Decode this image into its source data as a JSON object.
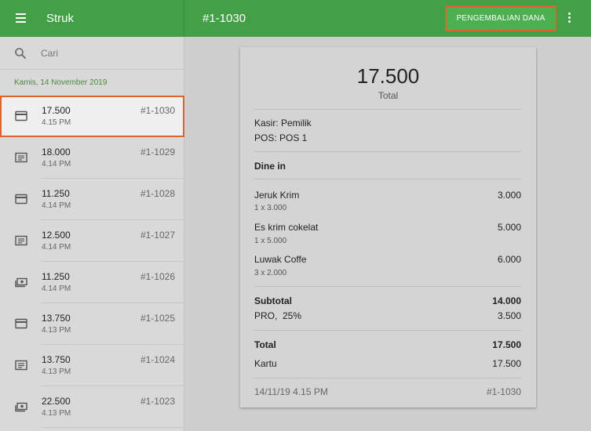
{
  "header": {
    "app_title": "Struk",
    "receipt_id": "#1-1030",
    "refund_label": "PENGEMBALIAN DANA",
    "menu_icon": "hamburger-menu-icon",
    "more_icon": "more-vert-icon"
  },
  "search": {
    "placeholder": "Cari"
  },
  "date_header": "Kamis, 14 November 2019",
  "receipts": [
    {
      "amount": "17.500",
      "time": "4.15 PM",
      "number": "#1-1030",
      "icon": "card-icon"
    },
    {
      "amount": "18.000",
      "time": "4.14 PM",
      "number": "#1-1029",
      "icon": "receipt-icon"
    },
    {
      "amount": "11.250",
      "time": "4.14 PM",
      "number": "#1-1028",
      "icon": "card-icon"
    },
    {
      "amount": "12.500",
      "time": "4.14 PM",
      "number": "#1-1027",
      "icon": "receipt-icon"
    },
    {
      "amount": "11.250",
      "time": "4.14 PM",
      "number": "#1-1026",
      "icon": "cash-icon"
    },
    {
      "amount": "13.750",
      "time": "4.13 PM",
      "number": "#1-1025",
      "icon": "card-icon"
    },
    {
      "amount": "13.750",
      "time": "4.13 PM",
      "number": "#1-1024",
      "icon": "receipt-icon"
    },
    {
      "amount": "22.500",
      "time": "4.13 PM",
      "number": "#1-1023",
      "icon": "cash-icon"
    }
  ],
  "receipt": {
    "total": "17.500",
    "total_label": "Total",
    "cashier": "Kasir: Pemilik",
    "pos": "POS: POS 1",
    "dining_option": "Dine in",
    "items": [
      {
        "name": "Jeruk Krim",
        "qty": "1 x 3.000",
        "price": "3.000"
      },
      {
        "name": "Es krim cokelat",
        "qty": "1 x 5.000",
        "price": "5.000"
      },
      {
        "name": "Luwak Coffe",
        "qty": "3 x 2.000",
        "price": "6.000"
      }
    ],
    "subtotal_label": "Subtotal",
    "subtotal": "14.000",
    "discount_label": "PRO,  25%",
    "discount": "3.500",
    "total_row_label": "Total",
    "total_row": "17.500",
    "payment_label": "Kartu",
    "payment": "17.500",
    "datetime": "14/11/19 4.15 PM",
    "number": "#1-1030"
  },
  "colors": {
    "primary": "#43a047",
    "highlight": "#e0632e",
    "date_text": "#4a8a3a"
  }
}
